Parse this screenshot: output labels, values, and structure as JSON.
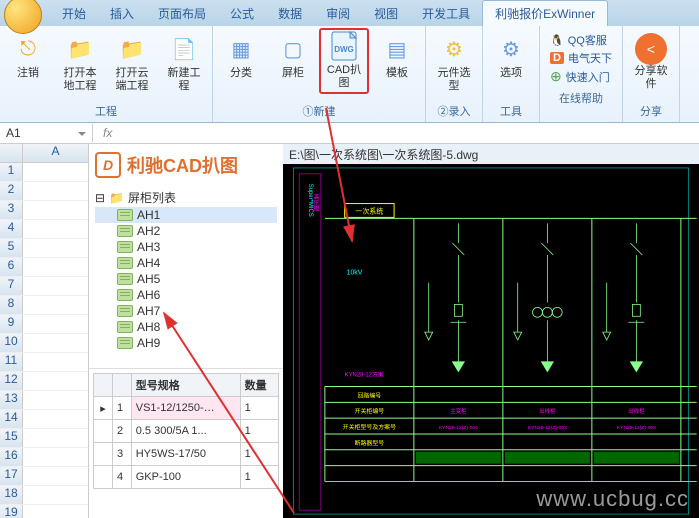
{
  "tabs": [
    "开始",
    "插入",
    "页面布局",
    "公式",
    "数据",
    "审阅",
    "视图",
    "开发工具",
    "利驰报价ExWinner"
  ],
  "active_tab": 8,
  "ribbon": {
    "g1": {
      "label": "工程",
      "items": [
        {
          "name": "logout-button",
          "ic": "⎋",
          "lbl": "注销",
          "color": "#f0a020"
        },
        {
          "name": "open-local-project-button",
          "ic": "📁",
          "lbl": "打开本地工程",
          "color": "#f0c040"
        },
        {
          "name": "open-cloud-project-button",
          "ic": "📁",
          "lbl": "打开云端工程",
          "color": "#f0c040"
        },
        {
          "name": "new-project-button",
          "ic": "📄",
          "lbl": "新建工程",
          "color": "#f0f0f0"
        }
      ]
    },
    "g2": {
      "label": "①新建",
      "items": [
        {
          "name": "category-button",
          "ic": "▦",
          "lbl": "分类"
        },
        {
          "name": "cabinet-button",
          "ic": "▢",
          "lbl": "屏柜"
        },
        {
          "name": "cad-scrape-button",
          "ic": "DWG",
          "lbl": "CAD扒图",
          "hl": true
        },
        {
          "name": "template-button",
          "ic": "▤",
          "lbl": "模板"
        }
      ]
    },
    "g3": {
      "label": "②录入",
      "items": [
        {
          "name": "component-select-button",
          "ic": "⚙",
          "lbl": "元件选型",
          "color": "#f0c040"
        }
      ]
    },
    "g4": {
      "label": "工具",
      "items": [
        {
          "name": "options-button",
          "ic": "⚙",
          "lbl": "选项",
          "color": "#6a9ae0"
        }
      ]
    },
    "g5": {
      "label": "在线帮助",
      "items": [
        {
          "name": "qq-support",
          "ic": "🐧",
          "lbl": "QQ客服"
        },
        {
          "name": "dianqi-tianxia",
          "ic": "D",
          "lbl": "电气天下"
        },
        {
          "name": "quick-start",
          "ic": "⊕",
          "lbl": "快速入门"
        }
      ]
    },
    "g6": {
      "label": "分享",
      "items": [
        {
          "name": "share-button",
          "lbl": "分享软件"
        }
      ]
    }
  },
  "cellref": "A1",
  "col_header": "A",
  "rows": [
    1,
    2,
    3,
    4,
    5,
    6,
    7,
    8,
    9,
    10,
    11,
    12,
    13,
    14,
    15,
    16,
    17,
    18,
    19
  ],
  "panel": {
    "title": "利驰CAD扒图",
    "tree_root": "屏柜列表",
    "tree_items": [
      "AH1",
      "AH2",
      "AH3",
      "AH4",
      "AH5",
      "AH6",
      "AH7",
      "AH8",
      "AH9"
    ],
    "tree_selected": 0,
    "spec_headers": [
      "",
      "",
      "型号规格",
      "数量"
    ],
    "spec_rows": [
      {
        "n": "1",
        "model": "VS1-12/1250-…",
        "qty": "1",
        "arrow": "▸"
      },
      {
        "n": "2",
        "model": "0.5 300/5A 1...",
        "qty": "1"
      },
      {
        "n": "3",
        "model": "HY5WS-17/50",
        "qty": "1"
      },
      {
        "n": "4",
        "model": "GKP-100",
        "qty": "1"
      }
    ]
  },
  "cad": {
    "path": "E:\\图\\一次系统图\\一次系统图-5.dwg",
    "title": "一次系统",
    "voltage": "10kV",
    "row_labels": [
      "回路编号",
      "开关柜编号",
      "开关柜型号及方案号",
      "断路器型号"
    ],
    "col_texts_row1": [
      "主变柜",
      "出线柜",
      "出线柜"
    ],
    "col_texts_row2": [
      "KYN28-12(Z)-004",
      "KYN28-12(Z)-003",
      "KYN28-12(Z)-003"
    ]
  },
  "watermark": "www.ucbug.cc"
}
